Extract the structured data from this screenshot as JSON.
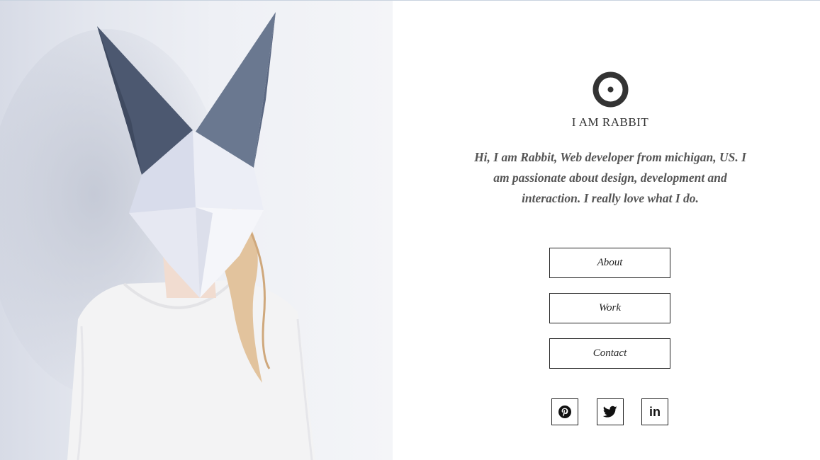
{
  "site": {
    "title": "I AM RABBIT",
    "intro": "Hi, I am Rabbit, Web developer from michigan, US. I am passionate about design, development and interaction. I really love what I do."
  },
  "nav": {
    "about_label": "About",
    "work_label": "Work",
    "contact_label": "Contact"
  },
  "social": {
    "linkedin_label": "in",
    "icons": [
      "pinterest-icon",
      "twitter-icon",
      "linkedin-icon"
    ]
  },
  "colors": {
    "accent": "#333333",
    "border": "#222222",
    "mask_dark": "#4c5870",
    "mask_light": "#e9ebf3"
  }
}
